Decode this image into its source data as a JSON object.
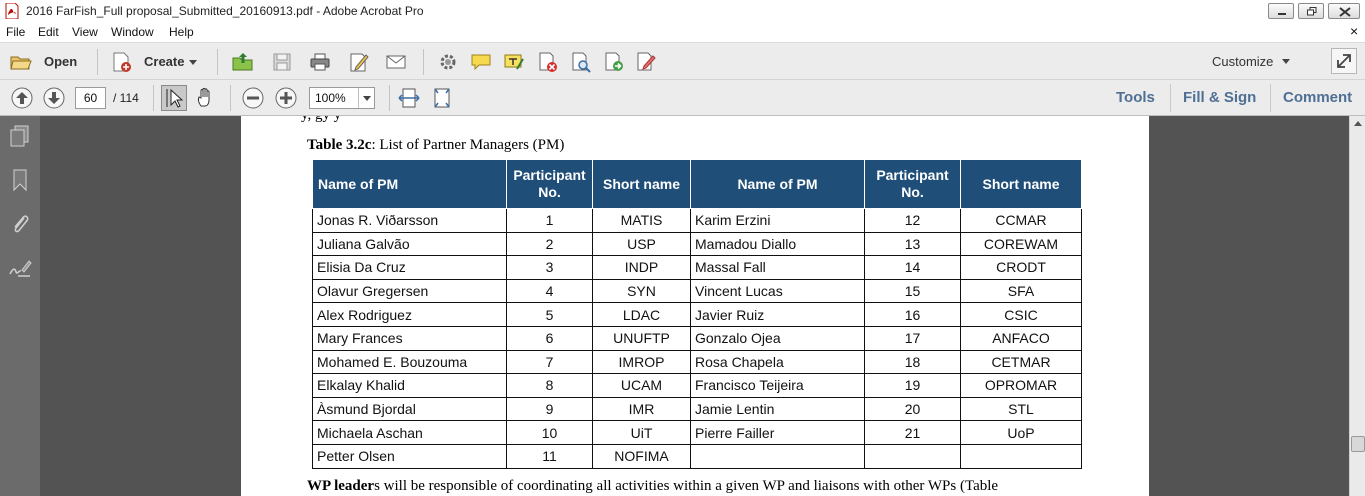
{
  "window": {
    "title": "2016 FarFish_Full proposal_Submitted_20160913.pdf - Adobe Acrobat Pro"
  },
  "menu": {
    "items": [
      "File",
      "Edit",
      "View",
      "Window",
      "Help"
    ],
    "close_glyph": "×"
  },
  "toolbar": {
    "open_label": "Open",
    "create_label": "Create",
    "customize_label": "Customize"
  },
  "navigation": {
    "current_page": "60",
    "total_pages": "/ 114",
    "zoom": "100%"
  },
  "panes": {
    "tools": "Tools",
    "fill_sign": "Fill & Sign",
    "comment": "Comment"
  },
  "document": {
    "cut_text": "y,                                                                    gy                                                              y",
    "caption_bold": "Table 3.2c",
    "caption_rest": ": List of Partner Managers (PM)",
    "table_headers": [
      "Name of PM",
      "Participant No.",
      "Short name",
      "Name of PM",
      "Participant No.",
      "Short name"
    ],
    "rows": [
      [
        "Jonas R. Viðarsson",
        "1",
        "MATIS",
        "Karim Erzini",
        "12",
        "CCMAR"
      ],
      [
        "Juliana Galvão",
        "2",
        "USP",
        "Mamadou Diallo",
        "13",
        "COREWAM"
      ],
      [
        "Elisia Da Cruz",
        "3",
        "INDP",
        "Massal Fall",
        "14",
        "CRODT"
      ],
      [
        "Olavur Gregersen",
        "4",
        "SYN",
        "Vincent Lucas",
        "15",
        "SFA"
      ],
      [
        "Alex Rodriguez",
        "5",
        "LDAC",
        "Javier Ruiz",
        "16",
        "CSIC"
      ],
      [
        "Mary Frances",
        "6",
        "UNUFTP",
        "Gonzalo Ojea",
        "17",
        "ANFACO"
      ],
      [
        "Mohamed E. Bouzouma",
        "7",
        "IMROP",
        "Rosa Chapela",
        "18",
        "CETMAR"
      ],
      [
        "Elkalay Khalid",
        "8",
        "UCAM",
        "Francisco Teijeira",
        "19",
        "OPROMAR"
      ],
      [
        "Àsmund Bjordal",
        "9",
        "IMR",
        "Jamie Lentin",
        "20",
        "STL"
      ],
      [
        "Michaela Aschan",
        "10",
        "UiT",
        "Pierre Failler",
        "21",
        "UoP"
      ],
      [
        "Petter Olsen",
        "11",
        "NOFIMA",
        "",
        "",
        ""
      ]
    ],
    "bottom_bold": "WP leader",
    "bottom_rest": "s will be responsible of coordinating all activities within a given WP and liaisons with other WPs (Table"
  }
}
